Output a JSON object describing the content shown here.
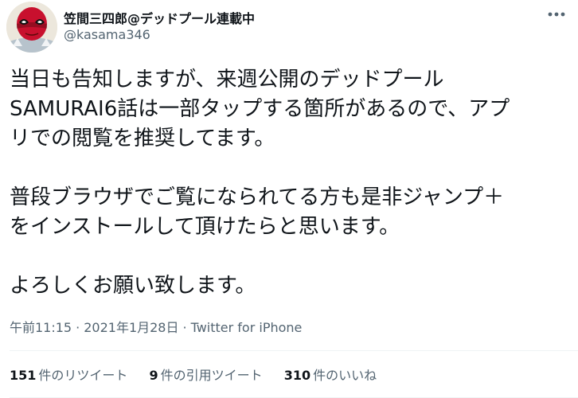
{
  "author": {
    "display_name": "笠間三四郎@デッドプール連載中",
    "handle": "@kasama346",
    "avatar": "deadpool-avatar-icon"
  },
  "more_icon": "more-horizontal-icon",
  "tweet": {
    "paragraphs": [
      {
        "lines": [
          "当日も告知しますが、来週公開のデッドプール",
          "SAMURAI6話は一部タップする箇所があるので、アプ",
          "リでの閲覧を推奨してます。"
        ]
      },
      {
        "lines": [
          "普段ブラウザでご覧になられてる方も是非ジャンプ＋",
          "をインストールして頂けたらと思います。"
        ]
      },
      {
        "lines": [
          "よろしくお願い致します。"
        ]
      }
    ]
  },
  "meta": {
    "time": "午前11:15",
    "separator_1": "·",
    "date": "2021年1月28日",
    "separator_2": "·",
    "source": "Twitter for iPhone"
  },
  "stats": {
    "retweets": {
      "count": "151",
      "label": "件のリツイート"
    },
    "quotes": {
      "count": "9",
      "label": "件の引用ツイート"
    },
    "likes": {
      "count": "310",
      "label": "件のいいね"
    }
  },
  "colors": {
    "text_primary": "#0f1419",
    "text_secondary": "#536471",
    "divider": "#eff3f4",
    "avatar_red": "#c8102e"
  }
}
